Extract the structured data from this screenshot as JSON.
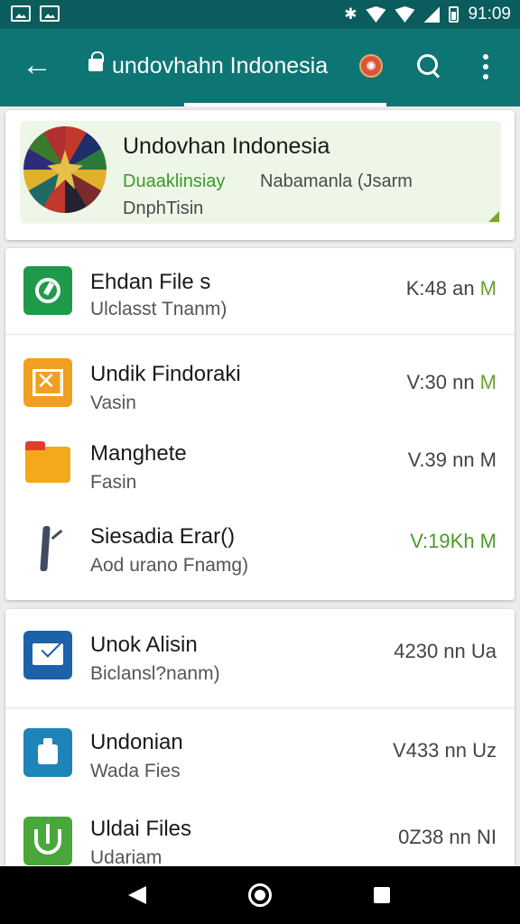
{
  "status_bar": {
    "time": "91:09",
    "icons": [
      "image-icon",
      "notification-icon",
      "bluetooth-icon",
      "wifi-icon",
      "signal-icon",
      "battery-icon"
    ]
  },
  "app_bar": {
    "title": "undovhahn Indonesia",
    "badge_icon": "flame-badge-icon",
    "colors": {
      "background": "#0e7575",
      "status": "#0b5c5d"
    }
  },
  "header_card": {
    "title": "Undovhan Indonesia",
    "subtitle_green": "Duaaklinsiay",
    "subtitle_gray": "Nabamanla (Jsarm",
    "subtitle2": "DnphTisin"
  },
  "list_card_1": [
    {
      "title": "Ehdan File s",
      "subtitle": "Ulclasst Tnanm)",
      "meta": "K:48 an ",
      "meta_suffix": "M",
      "icon": "clock-app-icon"
    },
    {
      "title": "Undik Findoraki",
      "subtitle": "Vasin",
      "meta": "V:30 nn ",
      "meta_suffix": "M",
      "icon": "image-app-icon"
    },
    {
      "title": "Manghete",
      "subtitle": "Fasin",
      "meta": "V.39 nn ",
      "meta_suffix": "M",
      "icon": "folder-icon"
    },
    {
      "title": "Siesadia Erar()",
      "subtitle": "Aod urano Fnamg)",
      "meta": "V:19Kh M",
      "meta_suffix": "",
      "icon": "brush-icon"
    }
  ],
  "list_card_2": [
    {
      "title": "Unok Alisin",
      "subtitle": "Biclansl?nanm)",
      "meta": "4230 nn Ua",
      "icon": "mail-icon"
    },
    {
      "title": "Undonian",
      "subtitle": "Wada Fies",
      "meta": "V433 nn Uz",
      "icon": "clipboard-icon"
    },
    {
      "title": "Uldai Files",
      "subtitle": "Udariam",
      "meta": "0Z38 nn NI",
      "icon": "download-icon"
    }
  ]
}
